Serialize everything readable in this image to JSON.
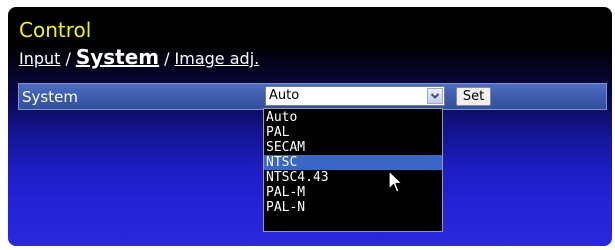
{
  "header": {
    "title": "Control"
  },
  "breadcrumb": {
    "items": [
      {
        "label": "Input"
      },
      {
        "label": "System"
      },
      {
        "label": "Image adj."
      }
    ],
    "separator": "/"
  },
  "system_row": {
    "label": "System",
    "select": {
      "value": "Auto",
      "options": [
        "Auto",
        "PAL",
        "SECAM",
        "NTSC",
        "NTSC4.43",
        "PAL-M",
        "PAL-N"
      ],
      "highlighted": "NTSC"
    },
    "set_label": "Set"
  },
  "icons": {
    "dropdown_arrow": "chevron-down-icon",
    "pointer": "mouse-cursor-icon"
  },
  "colors": {
    "title": "#f2f21c",
    "row_bar": "#3d5cae",
    "option_highlight": "#3a66c6",
    "panel_bottom": "#2a28de"
  }
}
